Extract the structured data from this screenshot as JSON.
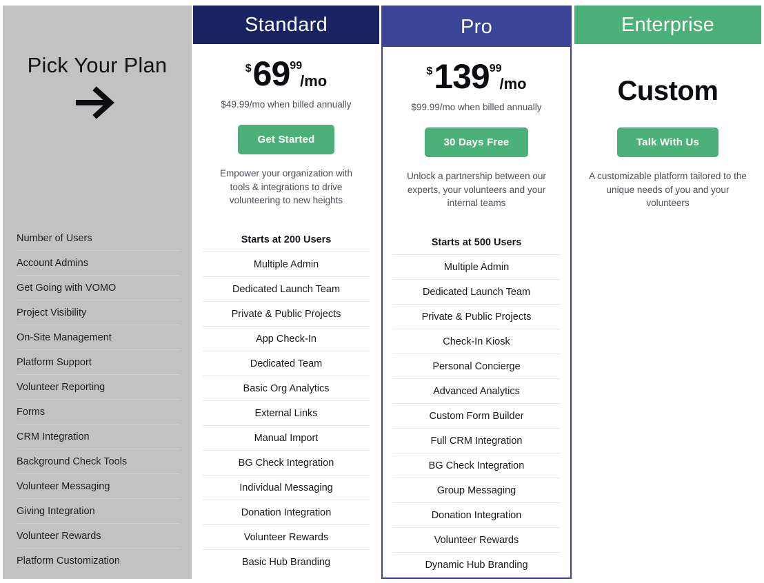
{
  "sidebar": {
    "title": "Pick Your Plan",
    "arrow_icon": "arrow-right-icon",
    "background_color": "#c2c2c2",
    "features": [
      "Number of Users",
      "Account Admins",
      "Get Going with VOMO",
      "Project Visibility",
      "On-Site Management",
      "Platform Support",
      "Volunteer Reporting",
      "Forms",
      "CRM Integration",
      "Background Check Tools",
      "Volunteer Messaging",
      "Giving Integration",
      "Volunteer Rewards",
      "Platform Customization"
    ]
  },
  "colors": {
    "standard_header": "#192262",
    "pro_header": "#3b4595",
    "enterprise_header": "#4cb079",
    "cta_green": "#4cb079",
    "pro_border": "#3b4595"
  },
  "plans": {
    "standard": {
      "name": "Standard",
      "currency": "$",
      "amount": "69",
      "cents": "99",
      "per": "/mo",
      "annual_note": "$49.99/mo when billed annually",
      "cta_label": "Get Started",
      "blurb": "Empower your organization with tools & integrations to drive volunteering to new heights",
      "features": [
        "Starts at 200 Users",
        "Multiple Admin",
        "Dedicated Launch Team",
        "Private & Public Projects",
        "App Check-In",
        "Dedicated Team",
        "Basic Org Analytics",
        "External Links",
        "Manual Import",
        "BG Check Integration",
        "Individual Messaging",
        "Donation Integration",
        "Volunteer Rewards",
        "Basic Hub Branding"
      ]
    },
    "pro": {
      "name": "Pro",
      "currency": "$",
      "amount": "139",
      "cents": "99",
      "per": "/mo",
      "annual_note": "$99.99/mo when billed annually",
      "cta_label": "30 Days Free",
      "blurb": "Unlock a partnership between our experts, your volunteers and your internal teams",
      "features": [
        "Starts at 500 Users",
        "Multiple Admin",
        "Dedicated Launch Team",
        "Private & Public Projects",
        "Check-In Kiosk",
        "Personal Concierge",
        "Advanced Analytics",
        "Custom Form Builder",
        "Full CRM Integration",
        "BG Check Integration",
        "Group Messaging",
        "Donation Integration",
        "Volunteer Rewards",
        "Dynamic Hub Branding"
      ]
    },
    "enterprise": {
      "name": "Enterprise",
      "price_word": "Custom",
      "cta_label": "Talk With Us",
      "blurb": "A customizable platform tailored to the unique needs of you and your volunteers"
    }
  }
}
